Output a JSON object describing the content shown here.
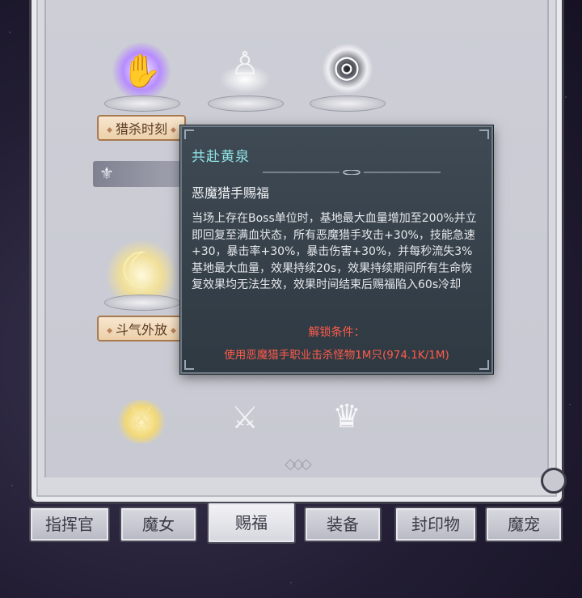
{
  "skills": [
    {
      "label": "猎杀时刻",
      "icon": "purple-claw-icon"
    },
    {
      "label": "",
      "icon": "figure-statue-icon"
    },
    {
      "label": "",
      "icon": "vortex-icon"
    },
    {
      "label": "斗气外放",
      "icon": "crescent-slash-icon"
    },
    {
      "label": "",
      "icon": "crossed-swords-icon"
    },
    {
      "label": "",
      "icon": "winged-swords-icon"
    },
    {
      "label": "",
      "icon": "cloaked-figure-icon"
    }
  ],
  "tooltip": {
    "title": "共赴黄泉",
    "subtitle": "恶魔猎手赐福",
    "description": "当场上存在Boss单位时，基地最大血量增加至200%并立即回复至满血状态，所有恶魔猎手攻击+30%，技能急速+30，暴击率+30%，暴击伤害+30%，并每秒流失3%基地最大血量，效果持续20s，效果持续期间所有生命恢复效果均无法生效，效果时间结束后赐福陷入60s冷却",
    "unlock_label": "解锁条件：",
    "unlock_condition": "使用恶魔猎手职业击杀怪物1M只(974.1K/1M)"
  },
  "tabs": [
    {
      "label": "指挥官",
      "active": false
    },
    {
      "label": "魔女",
      "active": false
    },
    {
      "label": "赐福",
      "active": true
    },
    {
      "label": "装备",
      "active": false
    },
    {
      "label": "封印物",
      "active": false
    },
    {
      "label": "魔宠",
      "active": false
    }
  ],
  "colors": {
    "tooltip_title": "#8fe6e6",
    "unlock_text": "#ff5b4a",
    "label_bg": "#ecd0aa"
  }
}
